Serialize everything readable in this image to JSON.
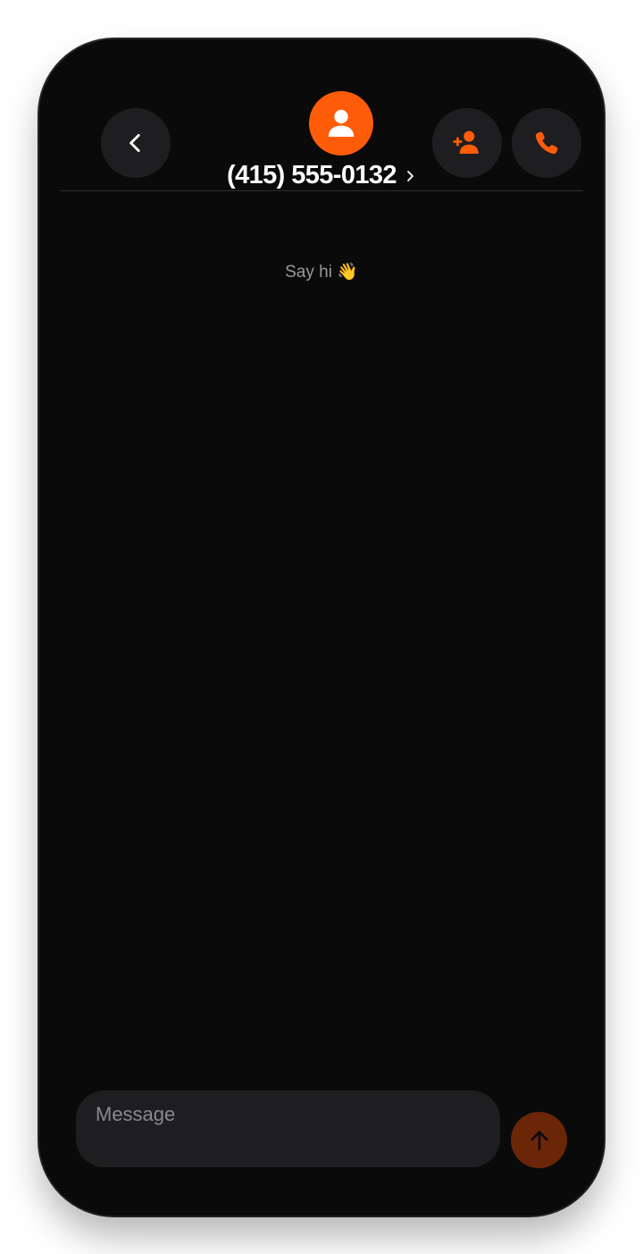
{
  "header": {
    "contact_name": "(415) 555-0132",
    "chevron_glyph": "›",
    "back_icon": "chevron-left-icon",
    "add_contact_icon": "person-add-icon",
    "call_icon": "phone-icon",
    "avatar_icon": "person-icon"
  },
  "conversation": {
    "empty_hint": "Say hi 👋"
  },
  "composer": {
    "placeholder": "Message",
    "value": "",
    "send_icon": "arrow-up-icon"
  },
  "colors": {
    "accent": "#ff5c0a",
    "background": "#0a0a0a",
    "button_bg": "#1e1e20",
    "send_bg": "#6b2608"
  }
}
